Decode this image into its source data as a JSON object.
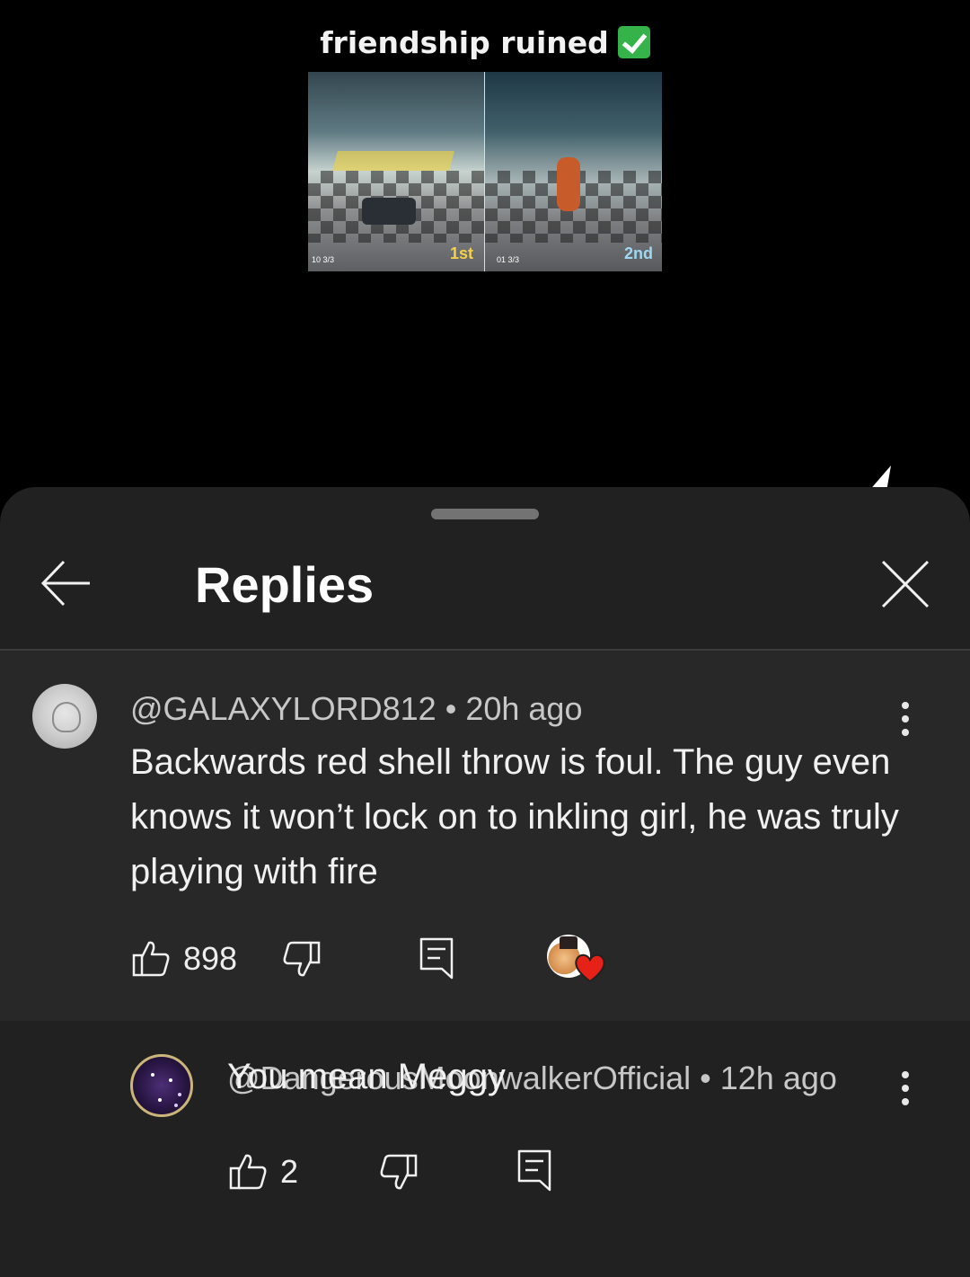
{
  "video": {
    "caption": "friendship ruined",
    "thumbnail": {
      "banner_text": "FINISH!",
      "left_place": "1st",
      "right_place": "2nd",
      "left_hud": "10 3/3",
      "right_hud": "01 3/3"
    }
  },
  "panel": {
    "title": "Replies",
    "back_icon": "arrow-left-icon",
    "close_icon": "close-icon"
  },
  "comment": {
    "author": "@GALAXYLORD812",
    "time": "20h ago",
    "text": "Backwards red shell throw is foul. The guy even knows it won’t lock on to inkling girl, he was truly playing with fire",
    "likes": "898",
    "liked_by_creator": true
  },
  "reply": {
    "author": "@DangerousMoonwalkerOfficial",
    "time": "12h ago",
    "text": "You mean Meggy",
    "likes": "2"
  },
  "colors": {
    "sheet_background": "#212121",
    "parent_comment_background": "#282828",
    "check_green": "#35b34a",
    "heart_red": "#e62117"
  }
}
